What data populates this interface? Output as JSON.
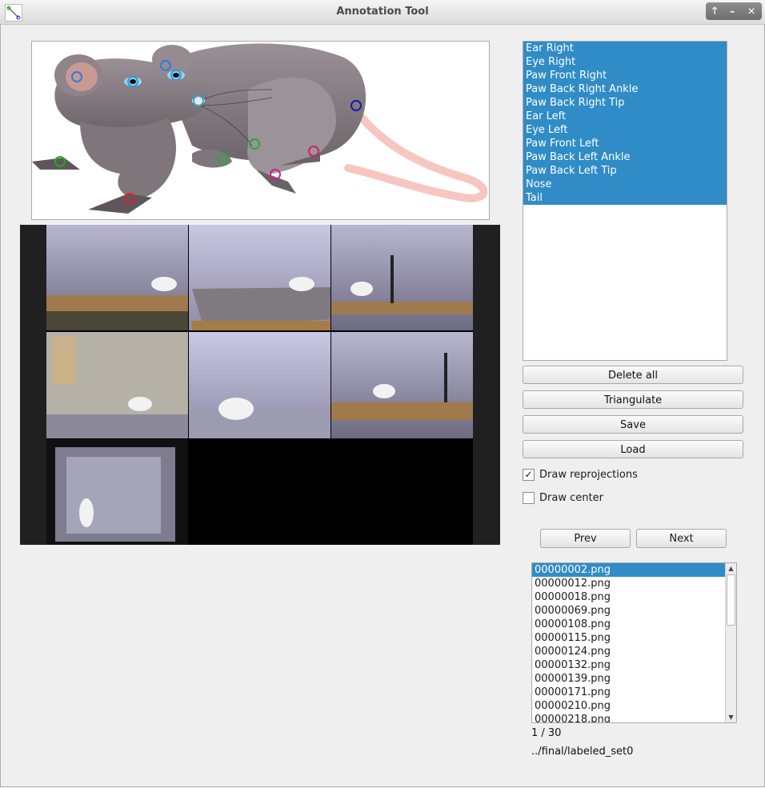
{
  "window": {
    "title": "Annotation Tool",
    "buttons": [
      "🡑",
      "–",
      "✕"
    ]
  },
  "keypoint_list": [
    "Ear Right",
    "Eye Right",
    "Paw Front Right",
    "Paw Back Right Ankle",
    "Paw Back Right Tip",
    "Ear Left",
    "Eye Left",
    "Paw Front Left",
    "Paw Back Left Ankle",
    "Paw Back Left Tip",
    "Nose",
    "Tail"
  ],
  "actions": {
    "delete_all": "Delete all",
    "triangulate": "Triangulate",
    "save": "Save",
    "load": "Load"
  },
  "options": {
    "draw_reprojections": {
      "label": "Draw reprojections",
      "checked": true
    },
    "draw_center": {
      "label": "Draw center",
      "checked": false
    }
  },
  "navigation": {
    "prev": "Prev",
    "next": "Next"
  },
  "files": {
    "items": [
      "00000002.png",
      "00000012.png",
      "00000018.png",
      "00000069.png",
      "00000108.png",
      "00000115.png",
      "00000124.png",
      "00000132.png",
      "00000139.png",
      "00000171.png",
      "00000210.png",
      "00000218.png"
    ],
    "selected": "00000002.png"
  },
  "status": {
    "counter": "1 / 30",
    "path": "../final/labeled_set0"
  },
  "colors": {
    "selection": "#308cc6",
    "rat_body": "#8a8087",
    "tail": "#f7c6c0"
  }
}
